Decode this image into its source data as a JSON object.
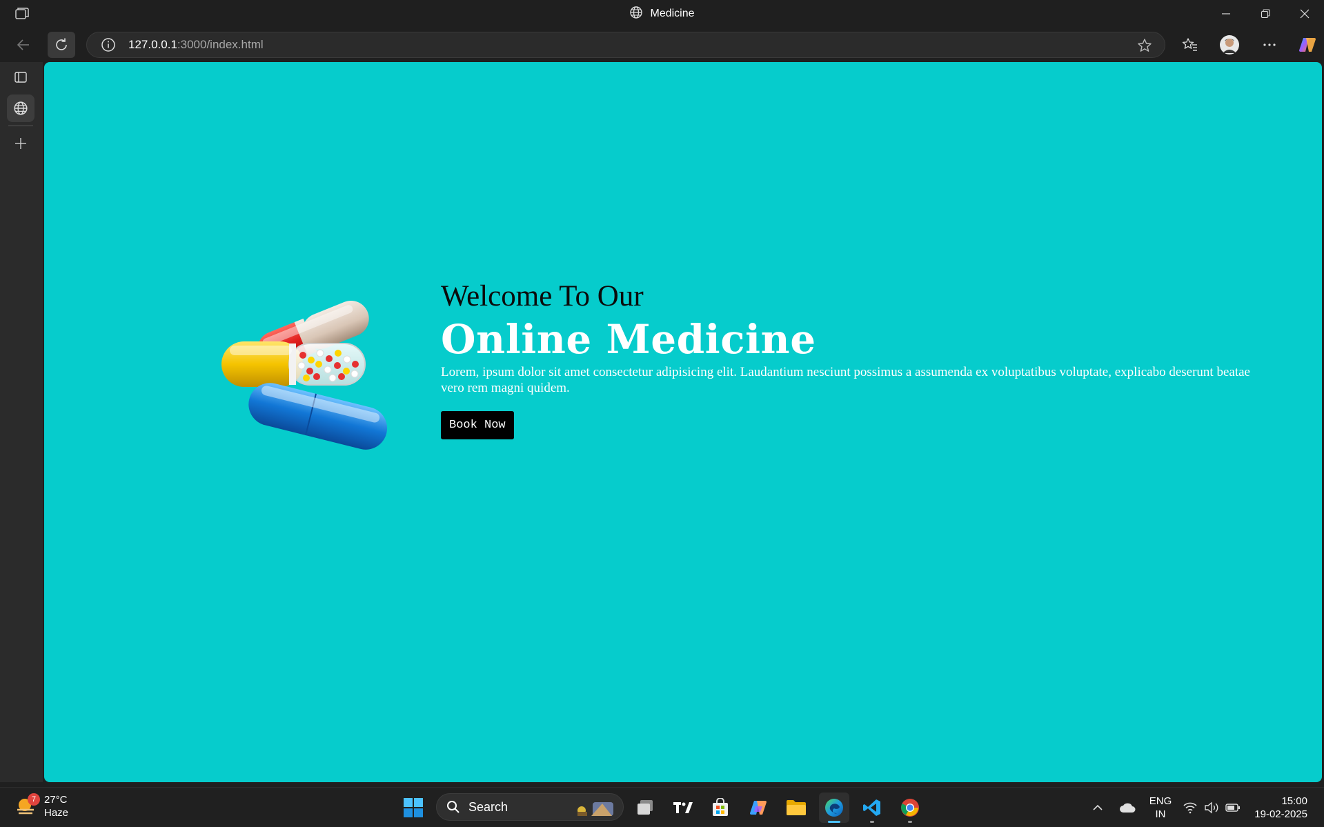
{
  "window": {
    "title": "Medicine",
    "controls": [
      "minimize",
      "restore",
      "close"
    ]
  },
  "toolbar": {
    "url_host": "127.0.0.1",
    "url_path": ":3000/index.html"
  },
  "page": {
    "background": "#06cccc",
    "welcome": "Welcome To Our",
    "headline": "Online Medicine",
    "description": "Lorem, ipsum dolor sit amet consectetur adipisicing elit. Laudantium nesciunt possimus a assumenda ex voluptatibus voluptate, explicabo deserunt beatae vero rem magni quidem.",
    "button_label": "Book Now"
  },
  "taskbar": {
    "weather": {
      "temp": "27°C",
      "condition": "Haze",
      "badge": "7"
    },
    "search_label": "Search",
    "language_line1": "ENG",
    "language_line2": "IN",
    "time": "15:00",
    "date": "19-02-2025"
  },
  "colors": {
    "accent": "#4cc2ff",
    "page_bg": "#06cccc",
    "chrome_bg": "#1f1f1f"
  }
}
